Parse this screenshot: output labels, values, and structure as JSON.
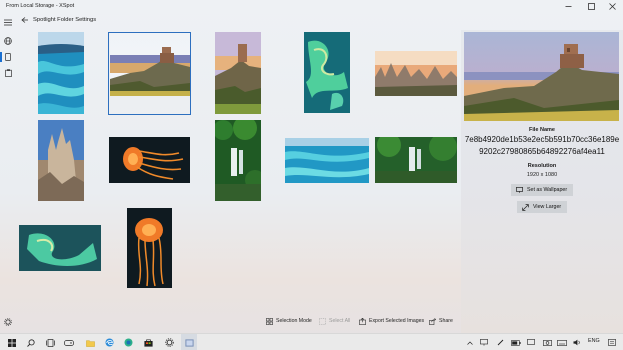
{
  "window": {
    "title": "From Local Storage - XSpot",
    "controls": [
      "minimize-icon",
      "maximize-icon",
      "close-icon"
    ]
  },
  "nav": {
    "items": [
      "hamburger-icon",
      "globe-icon",
      "tablet-icon",
      "clipboard-icon"
    ],
    "settings_icon": "gear-icon",
    "back_icon": "back-arrow-icon"
  },
  "header": {
    "title": "Spotlight Folder Settings"
  },
  "gallery": {
    "images": [
      "turquoise-sea-aerial",
      "castle-ruin-cliff-sunset",
      "castle-ruin-cliff",
      "aerial-green-reef",
      "rock-spires-sunset",
      "fairy-chimney-rocks",
      "jellyfish-orange-dark",
      "jungle-waterfall",
      "turquoise-sea-aerial-wide",
      "jungle-waterfall-wide",
      "aerial-green-reef-wide",
      "jellyfish-orange-tall"
    ],
    "selected_index": 1
  },
  "details": {
    "file_name_label": "File Name",
    "file_name_line1": "7e8b4920de1b53e2ec5b591b70cc36e189e",
    "file_name_line2": "9202c27980865b64892276af4ea11",
    "resolution_label": "Resolution",
    "resolution_value": "1920 x 1080",
    "set_wallpaper_label": "Set as Wallpaper",
    "view_larger_label": "View Larger"
  },
  "commandbar": {
    "selection_mode": "Selection Mode",
    "select_all": "Select All",
    "export_selected": "Export Selected Images",
    "share": "Share"
  },
  "taskbar": {
    "language": "ENG",
    "icons": [
      "windows-start-icon",
      "search-icon",
      "task-view-icon",
      "file-explorer-icon",
      "edge-icon",
      "edge-dev-icon",
      "store-icon",
      "game-icon",
      "settings-icon",
      "xspot-app-icon"
    ],
    "tray_icons": [
      "chevron-up-icon",
      "network-icon",
      "pen-icon",
      "battery-icon",
      "display-icon",
      "keyboard-icon",
      "camera-icon",
      "volume-icon",
      "notification-icon"
    ]
  },
  "colors": {
    "accent": "#2d6fbf",
    "taskbar": "#eaeaea",
    "button": "#cfd2d6"
  }
}
